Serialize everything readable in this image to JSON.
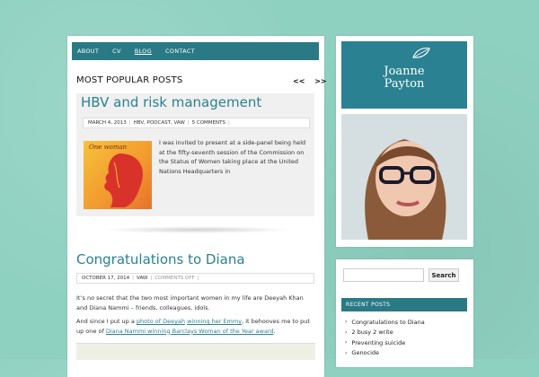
{
  "nav": {
    "items": [
      {
        "label": "ABOUT"
      },
      {
        "label": "CV"
      },
      {
        "label": "BLOG"
      },
      {
        "label": "CONTACT"
      }
    ],
    "active_index": 2
  },
  "popular": {
    "heading": "MOST POPULAR POSTS",
    "prev": "<<",
    "next": ">>",
    "post": {
      "title": "HBV and risk management",
      "date": "MARCH 4, 2013",
      "tags": "HBV, PODCAST, VAW",
      "comments": "5 COMMENTS",
      "thumb_text": "One woman",
      "excerpt": "I was invited to present at a side-panel being held at the fifty-seventh session of the Commission on the Status of Women taking place at the United Nations Headquarters in"
    }
  },
  "post2": {
    "title": "Congratulations to Diana",
    "date": "OCTOBER 17, 2014",
    "tag": "VAW",
    "comments": "COMMENTS OFF",
    "para1": "It’s no secret that the two most important women in my life are Deeyah Khan and Diana Nammi – friends, colleagues, idols.",
    "para2_pre": "And since I put up a ",
    "para2_link1": "photo of Deeyah",
    "para2_space": " ",
    "para2_link2": "winning her Emmy",
    "para2_mid": ", it behooves me to put up one of ",
    "para2_link3": "Diana Nammi winning Barclays Woman of the Year award",
    "para2_end": "."
  },
  "sidebar": {
    "logo_line1": "Joanne",
    "logo_line2": "Payton",
    "search_button": "Search",
    "search_value": "",
    "recent_heading": "RECENT POSTS",
    "recent_posts": [
      "Congratulations to Diana",
      "2 busy 2 write",
      "Preventing suicide",
      "Genocide"
    ]
  },
  "colors": {
    "background": "#8fd1c1",
    "accent": "#2a7a86",
    "title": "#2a8191"
  }
}
